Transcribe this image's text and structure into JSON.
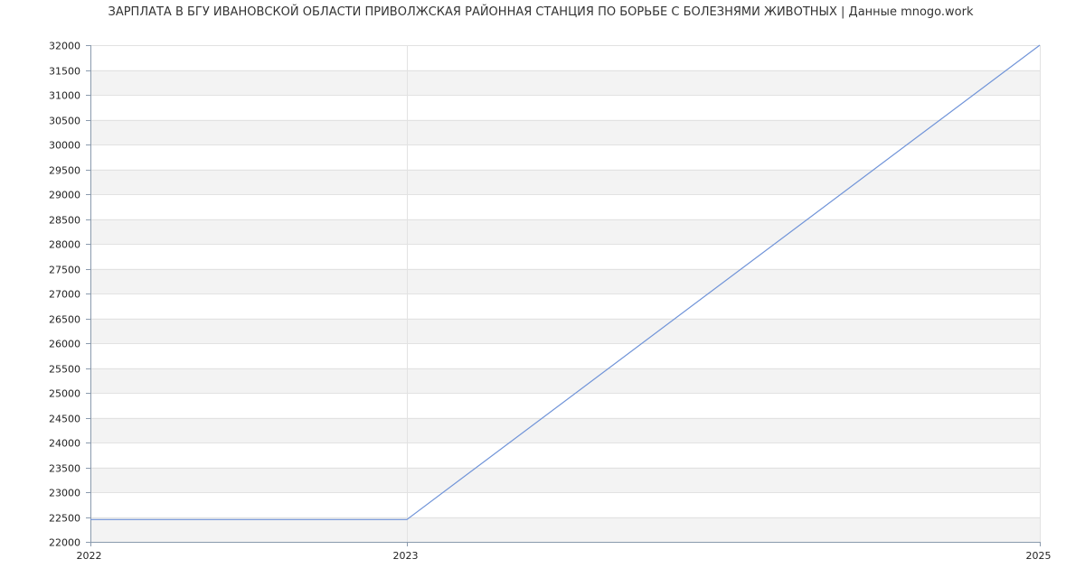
{
  "chart_data": {
    "type": "line",
    "title": "ЗАРПЛАТА В БГУ ИВАНОВСКОЙ ОБЛАСТИ ПРИВОЛЖСКАЯ РАЙОННАЯ СТАНЦИЯ ПО БОРЬБЕ С БОЛЕЗНЯМИ ЖИВОТНЫХ | Данные mnogo.work",
    "xlabel": "",
    "ylabel": "",
    "x_ticks": [
      "2022",
      "2023",
      "2025"
    ],
    "x": [
      "2022",
      "2023",
      "2025"
    ],
    "series": [
      {
        "values": [
          22450,
          22450,
          32000
        ],
        "color": "#6f93d8"
      }
    ],
    "ylim": [
      22000,
      32000
    ],
    "y_ticks": [
      22000,
      22500,
      23000,
      23500,
      24000,
      24500,
      25000,
      25500,
      26000,
      26500,
      27000,
      27500,
      28000,
      28500,
      29000,
      29500,
      30000,
      30500,
      31000,
      31500,
      32000
    ],
    "grid": true,
    "band_colors": [
      "#f3f3f3",
      "#ffffff"
    ],
    "grid_color": "#e2e2e2",
    "axis_color": "#8a9aad"
  }
}
